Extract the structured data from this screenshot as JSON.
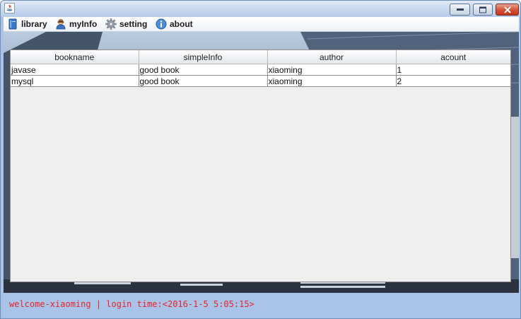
{
  "window": {
    "buttons": [
      "minimize",
      "maximize",
      "close"
    ]
  },
  "menubar": {
    "items": [
      {
        "label": "library",
        "icon": "book-icon"
      },
      {
        "label": "myInfo",
        "icon": "user-icon"
      },
      {
        "label": "setting",
        "icon": "gear-icon"
      },
      {
        "label": "about",
        "icon": "info-icon"
      }
    ]
  },
  "table": {
    "columns": [
      "bookname",
      "simpleInfo",
      "author",
      "acount"
    ],
    "rows": [
      [
        "javase",
        "good book",
        "xiaoming",
        "1"
      ],
      [
        "mysql",
        "good book",
        "xiaoming",
        "2"
      ]
    ]
  },
  "status": {
    "text": "welcome-xiaoming | login time:<2016-1-5 5:05:15>"
  },
  "colors": {
    "status_text": "#e8232b",
    "frame": "#a9c4e6"
  }
}
